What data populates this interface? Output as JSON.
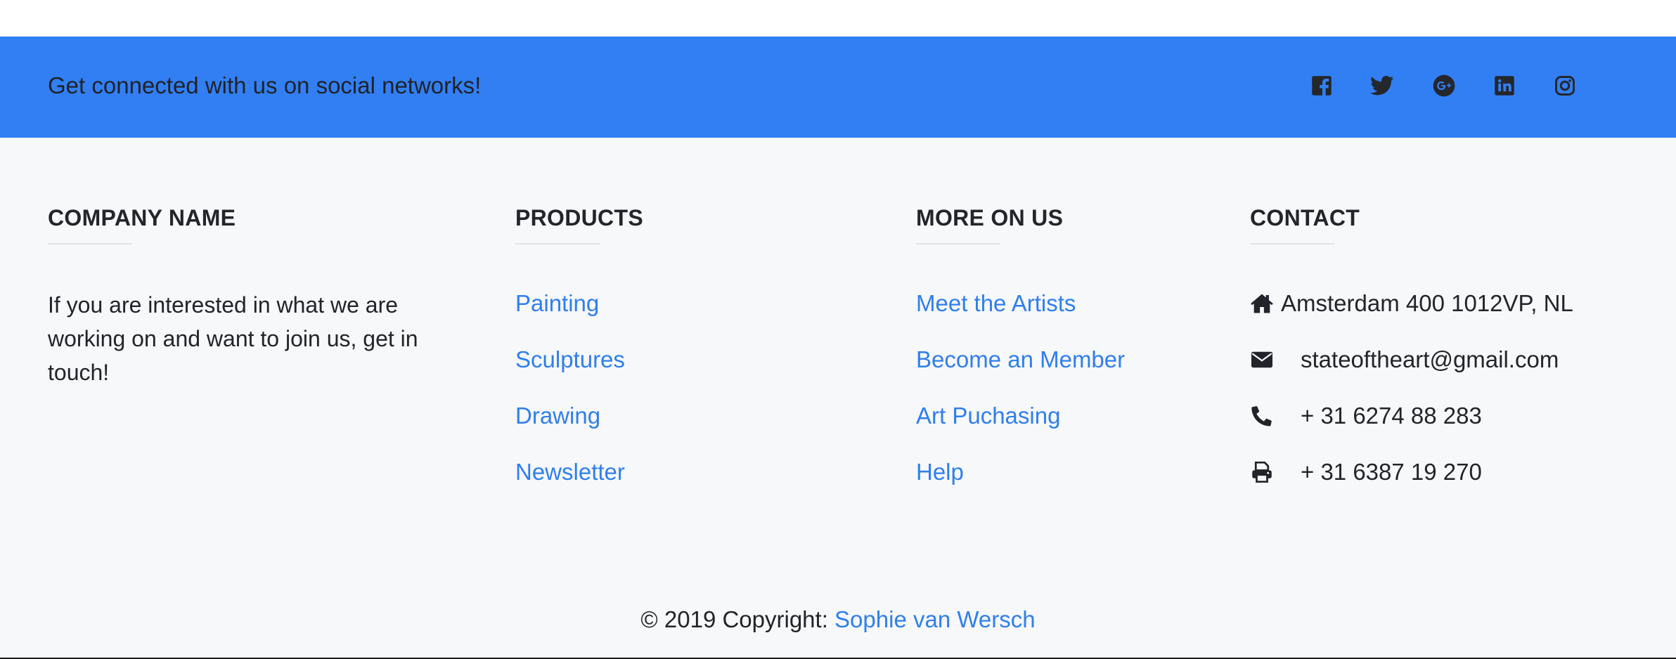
{
  "social_bar": {
    "text": "Get connected with us on social networks!",
    "background_color": "#327ff4",
    "icons": [
      {
        "name": "facebook-icon"
      },
      {
        "name": "twitter-icon"
      },
      {
        "name": "google-plus-icon"
      },
      {
        "name": "linkedin-icon"
      },
      {
        "name": "instagram-icon"
      }
    ]
  },
  "company": {
    "heading": "COMPANY NAME",
    "text": "If you are interested in what we are working on and want to join us, get in touch!"
  },
  "products": {
    "heading": "PRODUCTS",
    "links": [
      "Painting",
      "Sculptures",
      "Drawing",
      "Newsletter"
    ]
  },
  "more_on_us": {
    "heading": "MORE ON US",
    "links": [
      "Meet the Artists",
      "Become an Member",
      "Art Puchasing",
      "Help"
    ]
  },
  "contact": {
    "heading": "CONTACT",
    "items": [
      {
        "icon": "home-icon",
        "text": "Amsterdam 400 1012VP, NL"
      },
      {
        "icon": "envelope-icon",
        "text": "stateoftheart@gmail.com"
      },
      {
        "icon": "phone-icon",
        "text": "+ 31 6274 88 283"
      },
      {
        "icon": "print-icon",
        "text": "+ 31 6387 19 270"
      }
    ]
  },
  "copyright": {
    "prefix": "© 2019 Copyright: ",
    "link": "Sophie van Wersch"
  },
  "colors": {
    "link": "#2f7fea",
    "footer_background": "#f7f8fa",
    "text": "#212429"
  }
}
